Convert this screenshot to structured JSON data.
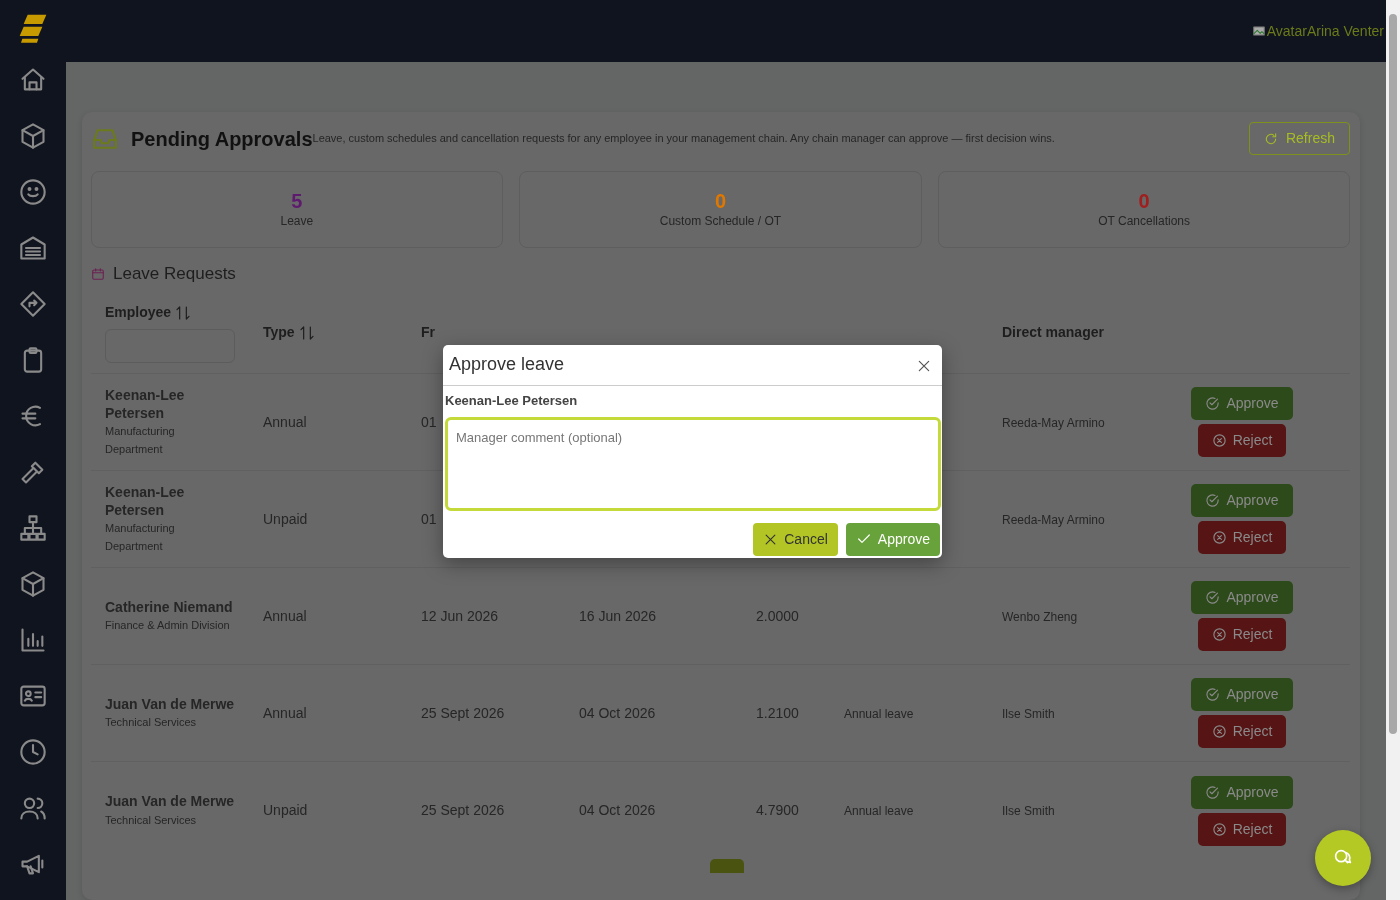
{
  "topbar": {
    "user": "AvatarArina Venter"
  },
  "page": {
    "title": "Pending Approvals",
    "subtitle": "Leave, custom schedules and cancellation requests for any employee in your management chain. Any chain manager can approve — first decision wins.",
    "refresh": "Refresh"
  },
  "stats": [
    {
      "value": "5",
      "label": "Leave",
      "color": "#5e1a6e"
    },
    {
      "value": "0",
      "label": "Custom Schedule / OT",
      "color": "#e07800"
    },
    {
      "value": "0",
      "label": "OT Cancellations",
      "color": "#a01e1e"
    }
  ],
  "section": {
    "title": "Leave Requests"
  },
  "table": {
    "columns": [
      {
        "label": "Employee",
        "sortable": true,
        "has_filter": true
      },
      {
        "label": "Type",
        "sortable": true,
        "has_filter": false
      },
      {
        "label": "Fr"
      },
      {},
      {},
      {},
      {
        "label": "Direct manager",
        "sortable": false,
        "has_filter": false
      },
      {}
    ],
    "rows": [
      {
        "name": "Keenan-Lee Petersen",
        "department": "Manufacturing Department",
        "type": "Annual",
        "from": "01",
        "manager": "Reeda-May Armino",
        "approve": "Approve",
        "reject": "Reject"
      },
      {
        "name": "Keenan-Lee Petersen",
        "department": "Manufacturing Department",
        "type": "Unpaid",
        "from": "01",
        "manager": "Reeda-May Armino",
        "approve": "Approve",
        "reject": "Reject"
      },
      {
        "name": "Catherine Niemand",
        "department": "Finance & Admin Division",
        "type": "Annual",
        "from": "12 Jun 2026",
        "to": "16 Jun 2026",
        "days": "2.0000",
        "manager": "Wenbo Zheng",
        "approve": "Approve",
        "reject": "Reject"
      },
      {
        "name": "Juan Van de Merwe",
        "department": "Technical Services",
        "type": "Annual",
        "from": "25 Sept 2026",
        "to": "04 Oct 2026",
        "days": "1.2100",
        "reason": "Annual leave",
        "manager": "Ilse Smith",
        "approve": "Approve",
        "reject": "Reject"
      },
      {
        "name": "Juan Van de Merwe",
        "department": "Technical Services",
        "type": "Unpaid",
        "from": "25 Sept 2026",
        "to": "04 Oct 2026",
        "days": "4.7900",
        "reason": "Annual leave",
        "manager": "Ilse Smith",
        "approve": "Approve",
        "reject": "Reject"
      }
    ]
  },
  "modal": {
    "title": "Approve leave",
    "employee": "Keenan-Lee Petersen",
    "comment_placeholder": "Manager comment (optional)",
    "cancel": "Cancel",
    "approve": "Approve"
  }
}
